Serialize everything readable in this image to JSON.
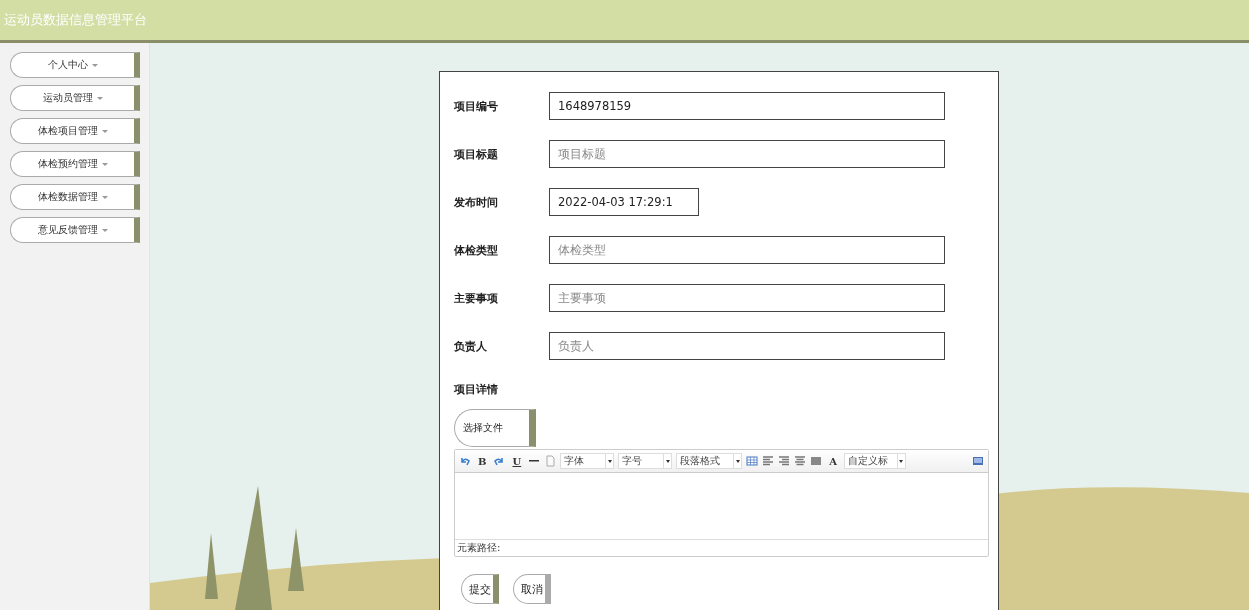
{
  "header": {
    "title": "运动员数据信息管理平台"
  },
  "sidebar": {
    "items": [
      {
        "label": "个人中心"
      },
      {
        "label": "运动员管理"
      },
      {
        "label": "体检项目管理"
      },
      {
        "label": "体检预约管理"
      },
      {
        "label": "体检数据管理"
      },
      {
        "label": "意见反馈管理"
      }
    ]
  },
  "form": {
    "fields": [
      {
        "label": "项目编号",
        "value": "1648978159",
        "kind": "wide"
      },
      {
        "label": "项目标题",
        "placeholder": "项目标题",
        "kind": "wide"
      },
      {
        "label": "发布时间",
        "value": "2022-04-03 17:29:1",
        "kind": "short"
      },
      {
        "label": "体检类型",
        "placeholder": "体检类型",
        "kind": "wide"
      },
      {
        "label": "主要事项",
        "placeholder": "主要事项",
        "kind": "wide"
      },
      {
        "label": "负责人",
        "placeholder": "负责人",
        "kind": "wide"
      }
    ],
    "detail": {
      "label": "项目详情",
      "file_button": "选择文件",
      "editor": {
        "bold": "B",
        "underline": "U",
        "font_color": "A",
        "selects": [
          "字体",
          "字号",
          "段落格式"
        ],
        "heading_select": "自定义标",
        "path_label": "元素路径:"
      }
    },
    "buttons": [
      {
        "label": "提交",
        "kind": "primary"
      },
      {
        "label": "取消",
        "kind": "secondary"
      }
    ]
  }
}
